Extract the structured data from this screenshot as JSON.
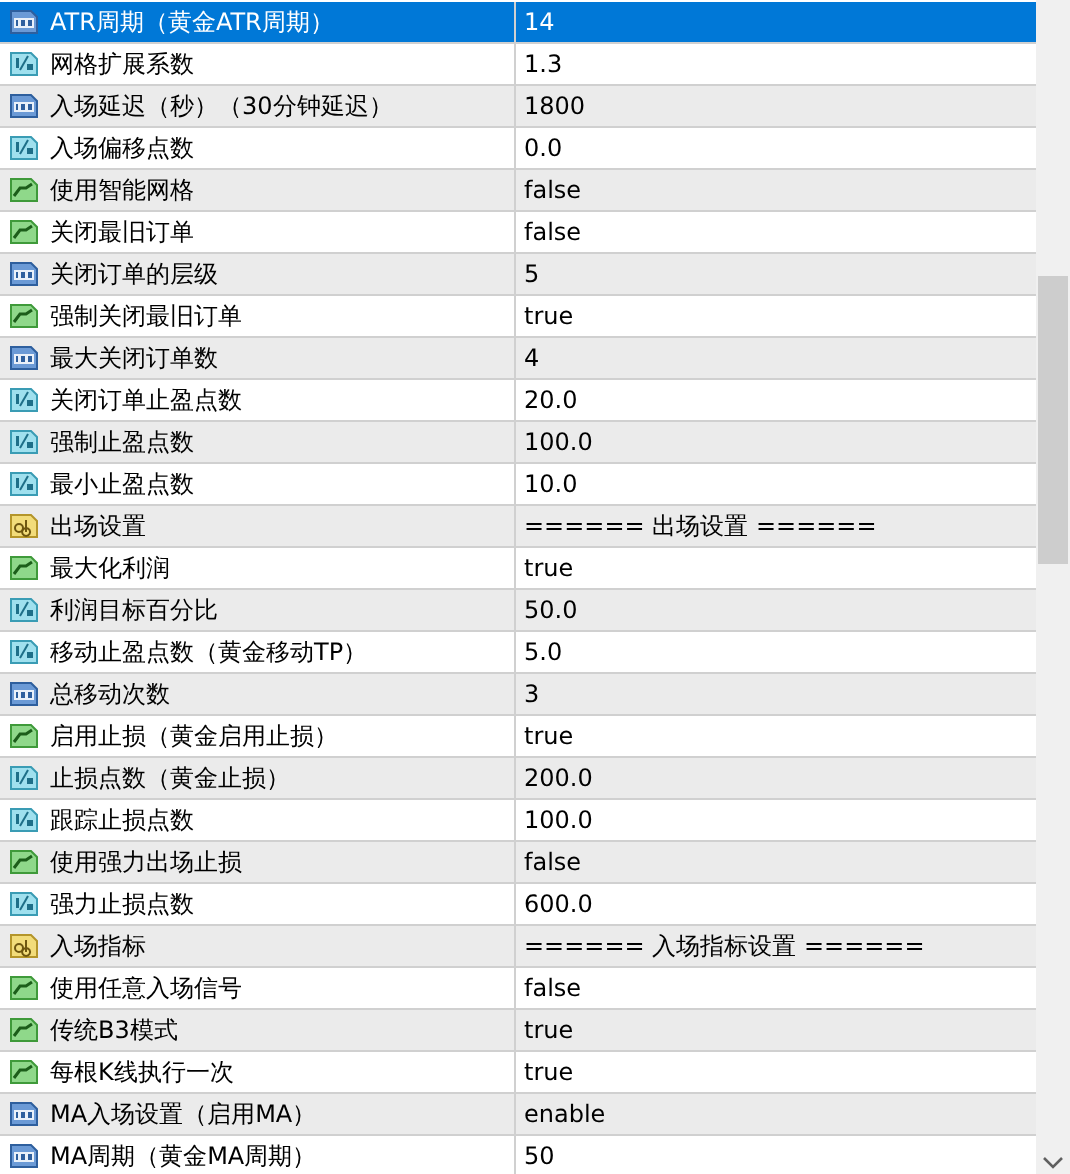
{
  "parameters": [
    {
      "name": "ATR周期（黄金ATR周期）",
      "value": "14",
      "kind": "int",
      "selected": true
    },
    {
      "name": "网格扩展系数",
      "value": "1.3",
      "kind": "double",
      "selected": false
    },
    {
      "name": "入场延迟（秒）（30分钟延迟）",
      "value": "1800",
      "kind": "int",
      "selected": false
    },
    {
      "name": "入场偏移点数",
      "value": "0.0",
      "kind": "double",
      "selected": false
    },
    {
      "name": "使用智能网格",
      "value": "false",
      "kind": "bool",
      "selected": false
    },
    {
      "name": "关闭最旧订单",
      "value": "false",
      "kind": "bool",
      "selected": false
    },
    {
      "name": "关闭订单的层级",
      "value": "5",
      "kind": "int",
      "selected": false
    },
    {
      "name": "强制关闭最旧订单",
      "value": "true",
      "kind": "bool",
      "selected": false
    },
    {
      "name": "最大关闭订单数",
      "value": "4",
      "kind": "int",
      "selected": false
    },
    {
      "name": "关闭订单止盈点数",
      "value": "20.0",
      "kind": "double",
      "selected": false
    },
    {
      "name": "强制止盈点数",
      "value": "100.0",
      "kind": "double",
      "selected": false
    },
    {
      "name": "最小止盈点数",
      "value": "10.0",
      "kind": "double",
      "selected": false
    },
    {
      "name": "出场设置",
      "value": "====== 出场设置 ======",
      "kind": "string",
      "selected": false
    },
    {
      "name": "最大化利润",
      "value": "true",
      "kind": "bool",
      "selected": false
    },
    {
      "name": "利润目标百分比",
      "value": "50.0",
      "kind": "double",
      "selected": false
    },
    {
      "name": "移动止盈点数（黄金移动TP）",
      "value": "5.0",
      "kind": "double",
      "selected": false
    },
    {
      "name": "总移动次数",
      "value": "3",
      "kind": "int",
      "selected": false
    },
    {
      "name": "启用止损（黄金启用止损）",
      "value": "true",
      "kind": "bool",
      "selected": false
    },
    {
      "name": "止损点数（黄金止损）",
      "value": "200.0",
      "kind": "double",
      "selected": false
    },
    {
      "name": "跟踪止损点数",
      "value": "100.0",
      "kind": "double",
      "selected": false
    },
    {
      "name": "使用强力出场止损",
      "value": "false",
      "kind": "bool",
      "selected": false
    },
    {
      "name": "强力止损点数",
      "value": "600.0",
      "kind": "double",
      "selected": false
    },
    {
      "name": "入场指标",
      "value": "====== 入场指标设置 ======",
      "kind": "string",
      "selected": false
    },
    {
      "name": "使用任意入场信号",
      "value": "false",
      "kind": "bool",
      "selected": false
    },
    {
      "name": "传统B3模式",
      "value": "true",
      "kind": "bool",
      "selected": false
    },
    {
      "name": "每根K线执行一次",
      "value": "true",
      "kind": "bool",
      "selected": false
    },
    {
      "name": "MA入场设置（启用MA）",
      "value": "enable",
      "kind": "int",
      "selected": false
    },
    {
      "name": "MA周期（黄金MA周期）",
      "value": "50",
      "kind": "int",
      "selected": false
    }
  ]
}
